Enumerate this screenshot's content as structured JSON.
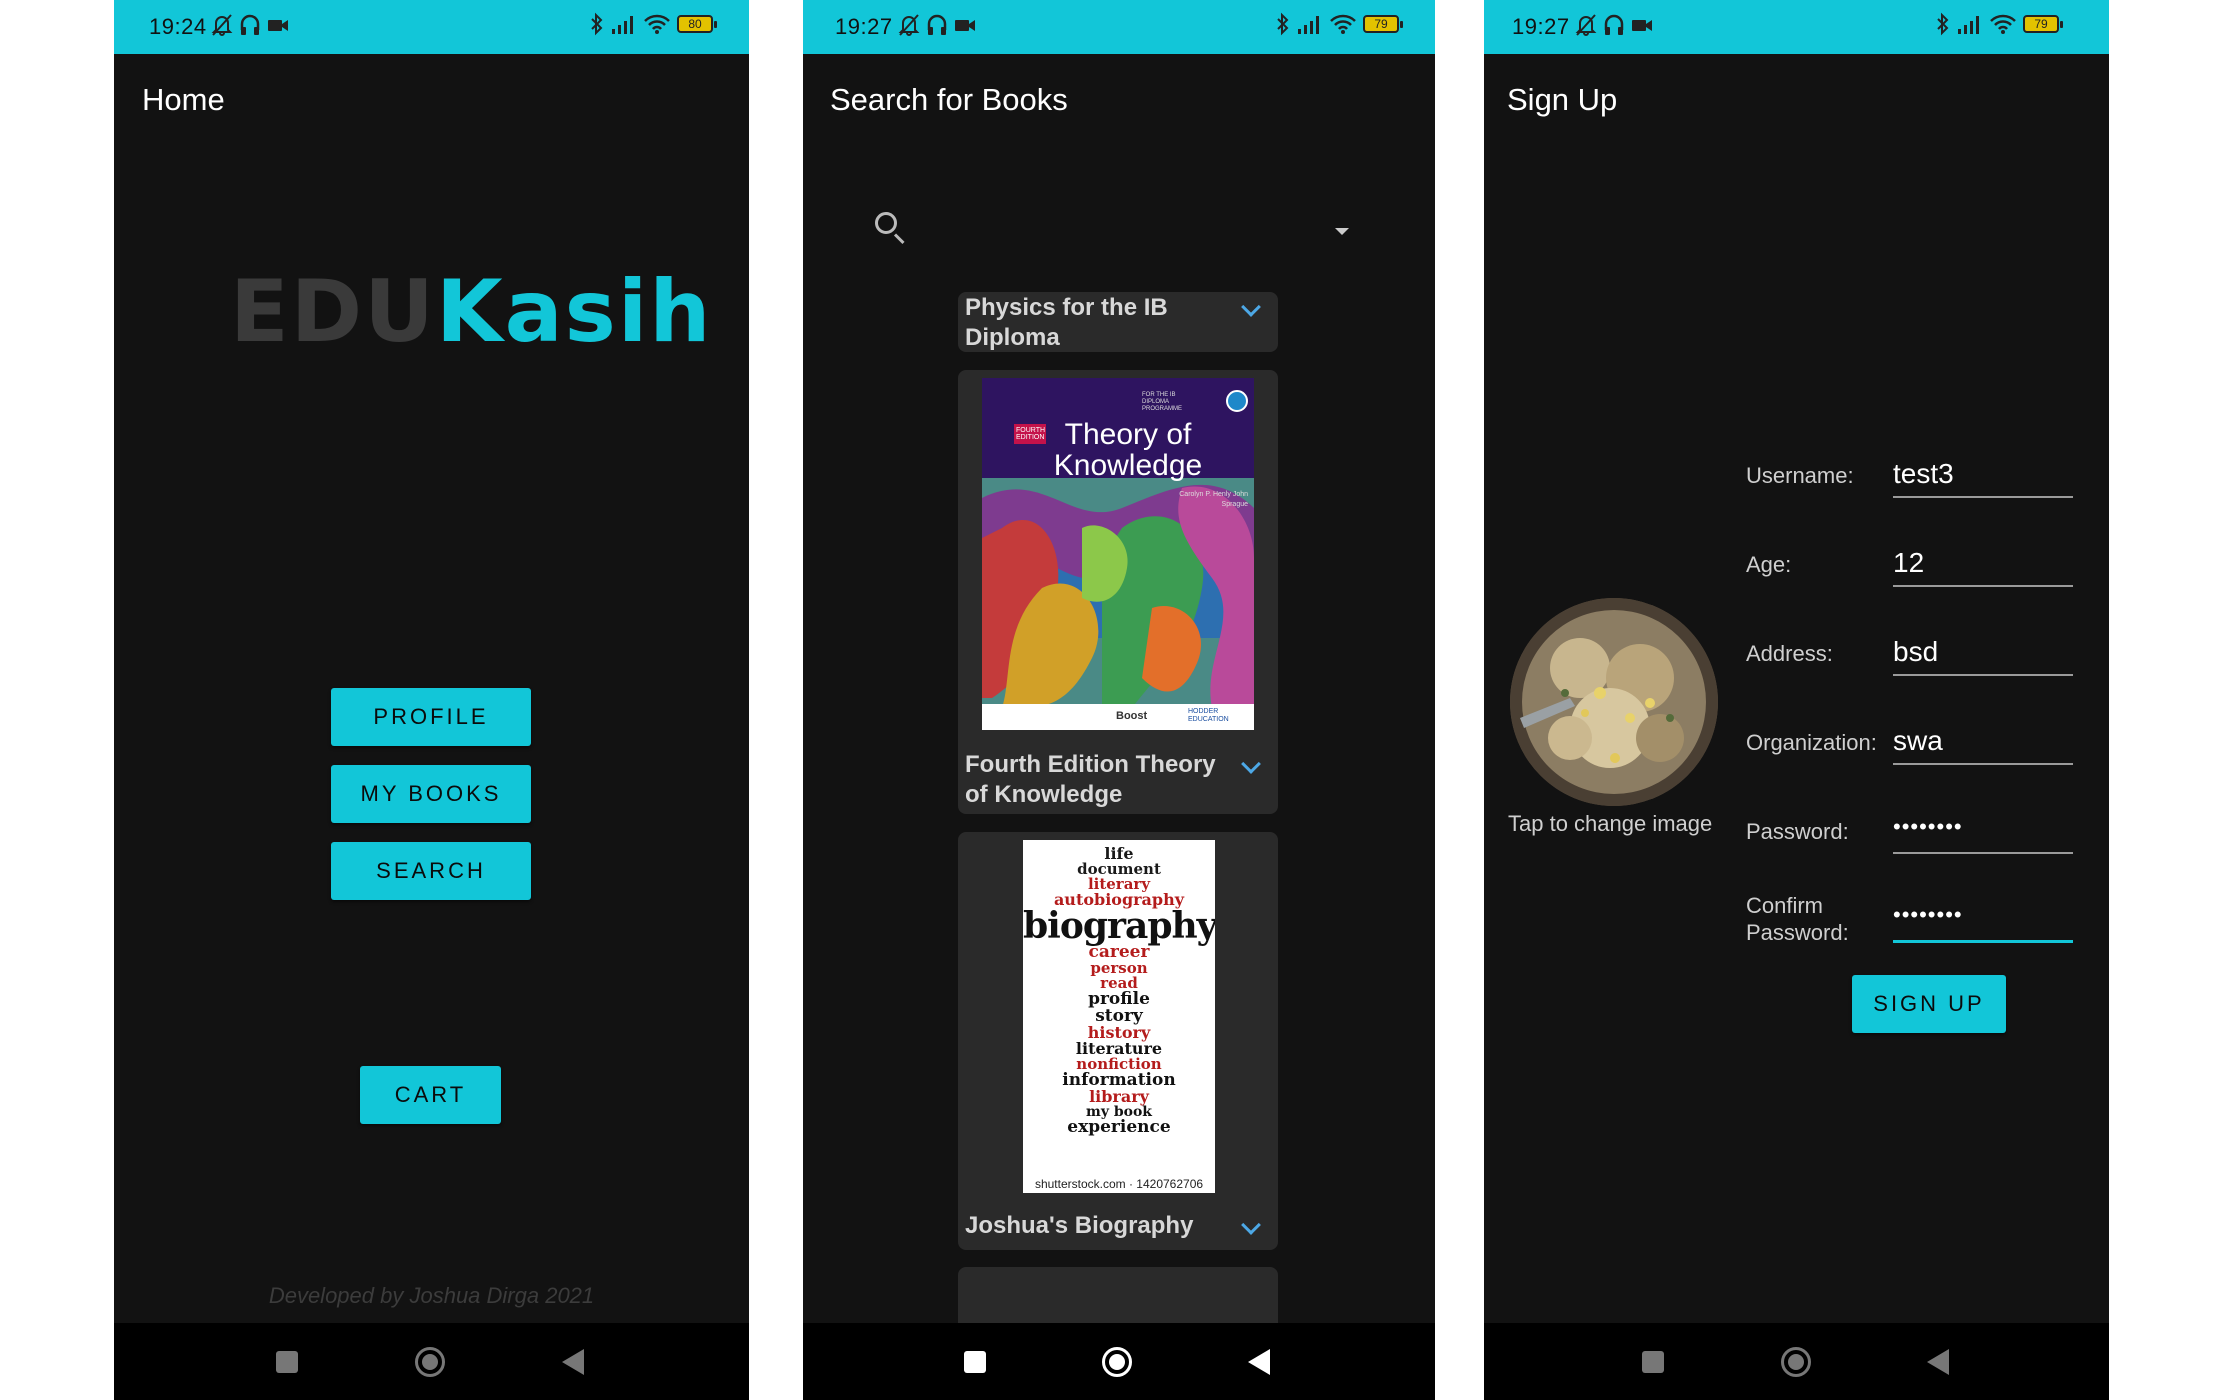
{
  "screens": {
    "home": {
      "status_time": "19:24",
      "battery": "80",
      "title": "Home",
      "logo": {
        "part1": "EDU",
        "part2": "Kasih"
      },
      "buttons": {
        "profile": "PROFILE",
        "my_books": "MY BOOKS",
        "search": "SEARCH",
        "cart": "CART"
      },
      "footer": "Developed by Joshua Dirga 2021"
    },
    "search": {
      "status_time": "19:27",
      "battery": "79",
      "title": "Search for Books",
      "books": [
        {
          "title": "Physics for the IB Diploma"
        },
        {
          "title": "Fourth Edition Theory of Knowledge",
          "cover": {
            "edition": "FOURTH EDITION",
            "program": "FOR THE IB DIPLOMA PROGRAMME",
            "title": "Theory of Knowledge",
            "authors": "Carolyn P. Henly John Sprague",
            "boost": "Boost",
            "publisher": "HODDER EDUCATION"
          }
        },
        {
          "title": "Joshua's Biography",
          "cover": {
            "words": [
              "life",
              "document",
              "literary",
              "autobiography",
              "biography",
              "career",
              "person",
              "read",
              "profile",
              "story",
              "history",
              "literature",
              "nonfiction",
              "information",
              "library",
              "my book",
              "experience"
            ],
            "watermark": "shutterstock.com · 1420762706"
          }
        }
      ]
    },
    "signup": {
      "status_time": "19:27",
      "battery": "79",
      "title": "Sign Up",
      "avatar_caption": "Tap to change image",
      "fields": {
        "username": {
          "label": "Username:",
          "value": "test3"
        },
        "age": {
          "label": "Age:",
          "value": "12"
        },
        "address": {
          "label": "Address:",
          "value": "bsd"
        },
        "organization": {
          "label": "Organization:",
          "value": "swa"
        },
        "password": {
          "label": "Password:",
          "value": "••••••••"
        },
        "confirm_password": {
          "label": "Confirm Password:",
          "value": "••••••••"
        }
      },
      "signup_button": "SIGN UP"
    }
  },
  "colors": {
    "accent": "#12c6d8",
    "background": "#121212",
    "card": "#2a2a2a",
    "expand": "#4da8e6"
  },
  "icons": [
    "notifications-off-icon",
    "headphones-icon",
    "videocam-icon",
    "bluetooth-icon",
    "signal-icon",
    "wifi-icon",
    "battery-icon",
    "search-icon",
    "dropdown-arrow-icon",
    "expand-icon"
  ]
}
